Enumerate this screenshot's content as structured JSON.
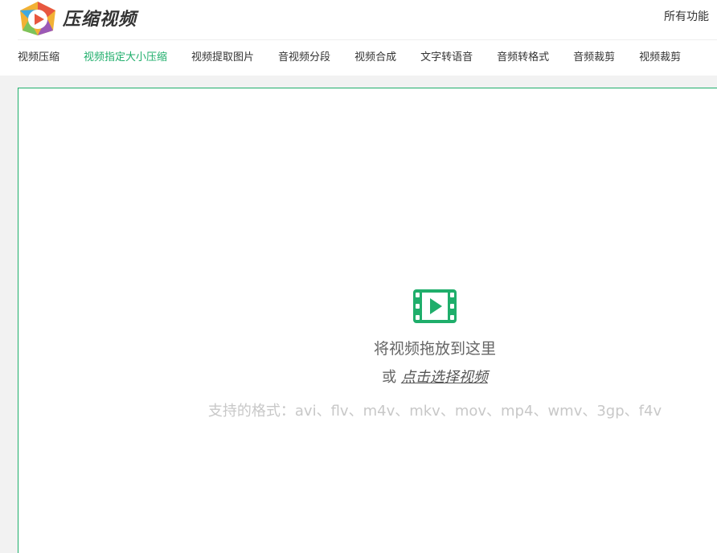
{
  "header": {
    "logo_text": "压缩视频",
    "all_features": "所有功能"
  },
  "nav": {
    "items": [
      {
        "label": "视频压缩"
      },
      {
        "label": "视频指定大小压缩",
        "active": true
      },
      {
        "label": "视频提取图片"
      },
      {
        "label": "音视频分段"
      },
      {
        "label": "视频合成"
      },
      {
        "label": "文字转语音"
      },
      {
        "label": "音频转格式"
      },
      {
        "label": "音频裁剪"
      },
      {
        "label": "视频裁剪"
      }
    ]
  },
  "upload": {
    "icon": "film-play-icon",
    "drop_text": "将视频拖放到这里",
    "or_text": "或",
    "choose_link": "点击选择视频",
    "formats": "支持的格式：avi、flv、m4v、mkv、mov、mp4、wmv、3gp、f4v"
  },
  "colors": {
    "accent": "#1fae6b",
    "text": "#333333",
    "muted": "#c8c8c8",
    "background": "#f2f2f2"
  }
}
